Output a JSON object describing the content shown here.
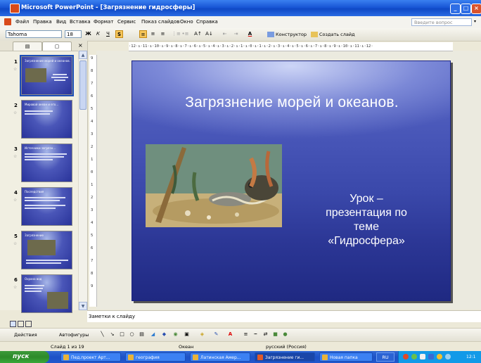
{
  "window": {
    "title": "Microsoft PowerPoint - [Загрязнение гидросферы]",
    "controls": [
      "_",
      "□",
      "×"
    ]
  },
  "menubar": {
    "items": [
      "Файл",
      "Правка",
      "Вид",
      "Вставка",
      "Формат",
      "Сервис",
      "Показ слайдов",
      "Окно",
      "Справка"
    ],
    "help_placeholder": "Введите вопрос"
  },
  "toolbar": {
    "font": "Tahoma",
    "size": "18",
    "bold": "Ж",
    "italic": "К",
    "underline": "Ч",
    "shadow": "S",
    "align_left": "≡",
    "align_center": "≡",
    "align_right": "≡",
    "font_color": "A",
    "designer": "Конструктор",
    "new_slide": "Создать слайд"
  },
  "left_panel": {
    "tabs": [
      "▤",
      "▢"
    ],
    "close": "×",
    "slides": [
      {
        "num": "1",
        "title": "Загрязнение морей и океанов.",
        "selected": true
      },
      {
        "num": "2",
        "title": "Мировой океан и его…",
        "selected": false
      },
      {
        "num": "3",
        "title": "Источники загрязн…",
        "selected": false
      },
      {
        "num": "4",
        "title": "Последствия",
        "selected": false
      },
      {
        "num": "5",
        "title": "Загрязнение",
        "selected": false
      },
      {
        "num": "6",
        "title": "Охрана вод",
        "selected": false
      }
    ]
  },
  "ruler": {
    "horizontal": "·12·ı·11·ı·10·ı·9·ı·8·ı·7·ı·6·ı·5·ı·4·ı·3·ı·2·ı·1·ı·0·ı·1·ı·2·ı·3·ı·4·ı·5·ı·6·ı·7·ı·8·ı·9·ı·10·ı·11·ı·12·",
    "vertical": [
      "9",
      "8",
      "7",
      "6",
      "5",
      "4",
      "3",
      "2",
      "1",
      "0",
      "1",
      "2",
      "3",
      "4",
      "5",
      "6",
      "7",
      "8",
      "9"
    ]
  },
  "slide": {
    "title": "Загрязнение морей и океанов.",
    "subtitle_lines": [
      "Урок –",
      "презентация по",
      "теме",
      "«Гидросфера»"
    ]
  },
  "notes": {
    "placeholder": "Заметки к слайду"
  },
  "drawing_toolbar": {
    "actions": "Действия",
    "autoshapes": "Автофигуры"
  },
  "statusbar": {
    "slide_count": "Слайд 1 из 19",
    "design": "Океан",
    "language": "русский (Россия)"
  },
  "taskbar": {
    "start": "пуск",
    "tasks": [
      {
        "label": "Пед.проект Арт...",
        "active": false
      },
      {
        "label": "география",
        "active": false
      },
      {
        "label": "Латинская Амер...",
        "active": false
      },
      {
        "label": "Загрязнение ги...",
        "active": true
      },
      {
        "label": "Новая папка",
        "active": false
      }
    ],
    "lang": "RU",
    "clock": "12:1"
  }
}
